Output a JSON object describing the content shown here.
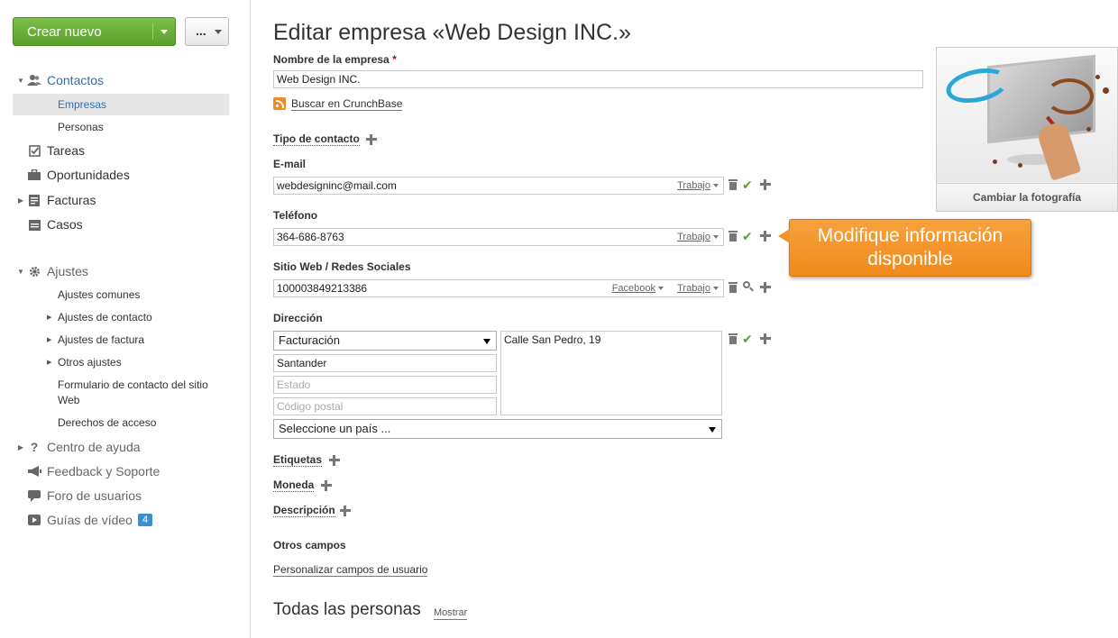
{
  "sidebar": {
    "create_label": "Crear nuevo",
    "more_label": "...",
    "contacts": "Contactos",
    "companies": "Empresas",
    "persons": "Personas",
    "tasks": "Tareas",
    "opportunities": "Oportunidades",
    "invoices": "Facturas",
    "cases": "Casos",
    "settings": "Ajustes",
    "settings_items": {
      "common": "Ajustes comunes",
      "contact": "Ajustes de contacto",
      "invoice": "Ajustes de factura",
      "other": "Otros ajustes",
      "webform": "Formulario de contacto del sitio Web",
      "access": "Derechos de acceso"
    },
    "help_center": "Centro de ayuda",
    "feedback": "Feedback y Soporte",
    "forum": "Foro de usuarios",
    "video_guides": "Guías de vídeo",
    "video_badge": "4"
  },
  "main": {
    "title": "Editar empresa «Web Design INC.»",
    "company_name_label": "Nombre de la empresa",
    "required_mark": "*",
    "company_name_value": "Web Design INC.",
    "crunchbase_link": "Buscar en CrunchBase",
    "contact_type_label": "Tipo de contacto",
    "email_label": "E-mail",
    "email_value": "webdesigninc@mail.com",
    "email_type": "Trabajo",
    "phone_label": "Teléfono",
    "phone_value": "364-686-8763",
    "phone_type": "Trabajo",
    "web_label": "Sitio Web / Redes Sociales",
    "web_value": "100003849213386",
    "web_network": "Facebook",
    "web_type": "Trabajo",
    "address_label": "Dirección",
    "address_type": "Facturación",
    "address_city": "Santander",
    "address_state_placeholder": "Estado",
    "address_zip_placeholder": "Código postal",
    "address_street": "Calle San Pedro, 19",
    "address_country": "Seleccione un país ...",
    "tags_label": "Etiquetas",
    "currency_label": "Moneda",
    "description_label": "Descripción",
    "other_fields_label": "Otros campos",
    "custom_fields_link": "Personalizar campos de usuario",
    "all_persons_title": "Todas las personas",
    "show_link": "Mostrar",
    "change_photo": "Cambiar la fotografía"
  },
  "tooltip": {
    "line1": "Modifique información",
    "line2": "disponible"
  },
  "colors": {
    "accent_blue": "#2b70b4",
    "create_green": "#6db33f",
    "tooltip_orange": "#f39424"
  }
}
